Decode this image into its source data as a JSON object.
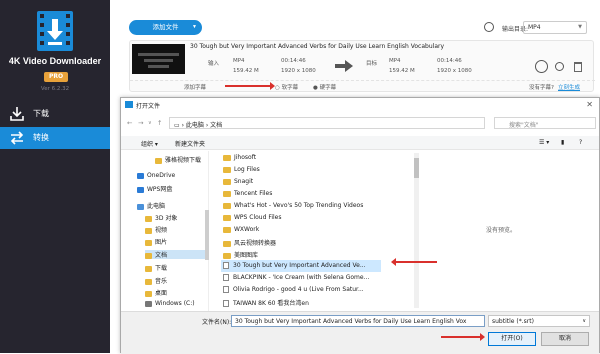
{
  "app": {
    "title": "4K Video Downloader",
    "pro": "PRO",
    "version": "Ver 6.2.32"
  },
  "sidebar": {
    "items": [
      {
        "label": "下载"
      },
      {
        "label": "转换"
      }
    ]
  },
  "header": {
    "add_file": "添加文件",
    "output_label": "输出目录:",
    "output_format": "MP4"
  },
  "task": {
    "title": "30 Tough but Very Important Advanced Verbs for Daily Use  Learn English Vocabulary",
    "input_label": "输入",
    "output_label": "目标",
    "in_format": "MP4",
    "in_duration": "00:14:46",
    "in_size": "159.42 M",
    "in_res": "1920 x 1080",
    "out_format": "MP4",
    "out_duration": "00:14:46",
    "out_size": "159.42 M",
    "out_res": "1920 x 1080",
    "add_subtitle": "添加字幕",
    "soft_sub": "软字幕",
    "hard_sub": "硬字幕",
    "no_subtitle": "没有字幕?",
    "online_gen": "立刻生成"
  },
  "dialog": {
    "title": "打开文件",
    "breadcrumb": [
      "此电脑",
      "文档"
    ],
    "search_placeholder": "搜索\"文档\"",
    "organize": "组织",
    "new_folder": "新建文件夹",
    "tree": [
      {
        "label": "雅格视频下载",
        "type": "folder"
      },
      {
        "label": "OneDrive",
        "type": "cloud"
      },
      {
        "label": "WPS网盘",
        "type": "cloud"
      },
      {
        "label": "此电脑",
        "type": "pc"
      },
      {
        "label": "3D 对象",
        "type": "folder"
      },
      {
        "label": "视频",
        "type": "folder"
      },
      {
        "label": "图片",
        "type": "folder"
      },
      {
        "label": "文档",
        "type": "folder"
      },
      {
        "label": "下载",
        "type": "folder"
      },
      {
        "label": "音乐",
        "type": "folder"
      },
      {
        "label": "桌面",
        "type": "folder"
      },
      {
        "label": "Windows (C:)",
        "type": "drive"
      }
    ],
    "files": [
      {
        "name": "Jihosoft",
        "type": "folder"
      },
      {
        "name": "Log Files",
        "type": "folder"
      },
      {
        "name": "Snagit",
        "type": "folder"
      },
      {
        "name": "Tencent Files",
        "type": "folder"
      },
      {
        "name": "What's Hot - Vevo's 50 Top Trending Videos",
        "type": "folder"
      },
      {
        "name": "WPS Cloud Files",
        "type": "folder"
      },
      {
        "name": "WXWork",
        "type": "folder"
      },
      {
        "name": "风云视频转换器",
        "type": "folder"
      },
      {
        "name": "美图图库",
        "type": "folder"
      },
      {
        "name": "30 Tough but Very Important Advanced Ve...",
        "type": "video",
        "selected": true
      },
      {
        "name": "BLACKPINK - 'Ice Cream (with Selena Gome...",
        "type": "video"
      },
      {
        "name": "Olivia Rodrigo - good 4 u (Live From Satur...",
        "type": "video"
      },
      {
        "name": "TAIWAN    8K 60 看我台湾en",
        "type": "video"
      }
    ],
    "no_preview": "没有预览。",
    "filename_label": "文件名(N):",
    "filename_value": "30 Tough but Very Important Advanced Verbs for Daily Use  Learn English Vox",
    "filter": "subtitle (*.srt)",
    "open": "打开(O)",
    "cancel": "取消"
  },
  "colors": {
    "sidebar_bg": "#26252f",
    "accent": "#1a8bd8",
    "pro": "#e8a23a",
    "arrow": "#d9302c"
  }
}
